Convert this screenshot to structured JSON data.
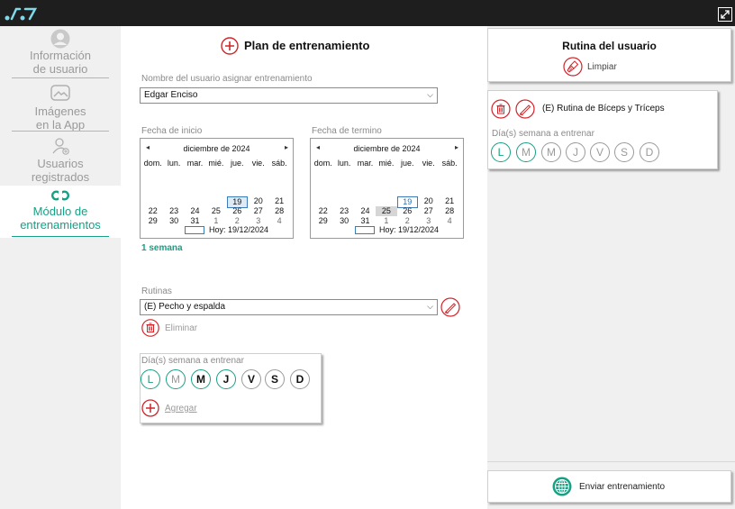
{
  "sidebar": {
    "items": [
      {
        "label_line1": "Información",
        "label_line2": "de usuario"
      },
      {
        "label_line1": "Imágenes",
        "label_line2": "en la App"
      },
      {
        "label_line1": "Usuarios",
        "label_line2": "registrados"
      },
      {
        "label_line1": "Módulo de",
        "label_line2": "entrenamientos",
        "active": true
      }
    ]
  },
  "plan": {
    "title": "Plan de entrenamiento",
    "user_label": "Nombre del usuario asignar entrenamiento",
    "user_value": "Edgar Enciso",
    "start_label": "Fecha de inicio",
    "end_label": "Fecha de termino",
    "duration": "1 semana",
    "routines_label": "Rutinas",
    "routine_value": "(E) Pecho y espalda",
    "delete_label": "Eliminar",
    "days_label": "Día(s) semana a entrenar",
    "add_label": "Agregar"
  },
  "calendar": {
    "month": "diciembre de 2024",
    "weekdays": [
      "dom.",
      "lun.",
      "mar.",
      "mié.",
      "jue.",
      "vie.",
      "sáb."
    ],
    "row1": [
      "22",
      "23",
      "24",
      "25",
      "26",
      "27",
      "28"
    ],
    "row2": [
      "29",
      "30",
      "31",
      "1",
      "2",
      "3",
      "4"
    ],
    "partial": [
      "19",
      "20",
      "21"
    ],
    "today_label": "Hoy: 19/12/2024"
  },
  "days": [
    "L",
    "M",
    "M",
    "J",
    "V",
    "S",
    "D"
  ],
  "right": {
    "title": "Rutina del usuario",
    "clear_label": "Limpiar",
    "routine_name": "(E) Rutina de Bíceps y Tríceps",
    "days_label": "Día(s) semana a entrenar",
    "send_label": "Enviar entrenamiento"
  },
  "colors": {
    "accent": "#16a085",
    "danger": "#d0252b",
    "titlebar": "#1e1e1e",
    "panel": "#f0f0f0"
  }
}
